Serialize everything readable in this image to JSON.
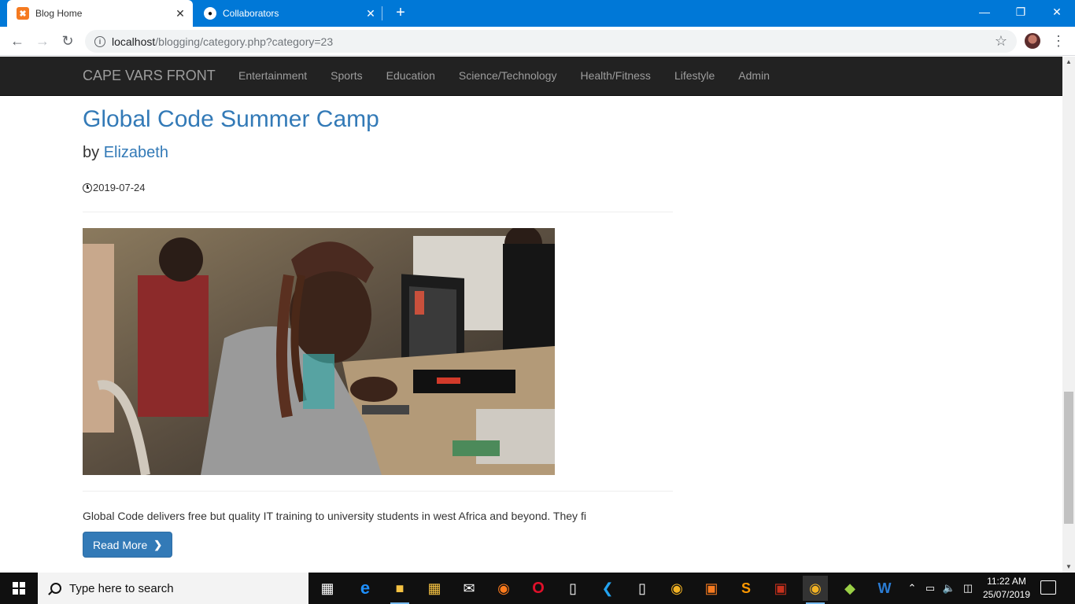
{
  "browser": {
    "tabs": [
      {
        "title": "Blog Home",
        "active": true,
        "icon": "xampp-icon"
      },
      {
        "title": "Collaborators",
        "active": false,
        "icon": "github-icon"
      }
    ],
    "new_tab_label": "+",
    "url_host": "localhost",
    "url_path": "/blogging/category.php?category=23",
    "accent_color": "#0078d7"
  },
  "site": {
    "brand": "CAPE VARS FRONT",
    "nav": [
      "Entertainment",
      "Sports",
      "Education",
      "Science/Technology",
      "Health/Fitness",
      "Lifestyle",
      "Admin"
    ],
    "navbar_color": "#222222",
    "link_color": "#337ab7"
  },
  "post": {
    "title": "Global Code Summer Camp",
    "by_label": "by",
    "author": "Elizabeth",
    "date": "2019-07-24",
    "image_alt": "Student working on electronics at a computer lab",
    "excerpt": "Global Code delivers free but quality IT training to university students in west Africa and beyond. They fi",
    "read_more_label": "Read More"
  },
  "taskbar": {
    "search_placeholder": "Type here to search",
    "time": "11:22 AM",
    "date": "25/07/2019",
    "apps": [
      "task-view-icon",
      "edge-icon",
      "file-explorer-icon",
      "store-icon",
      "mail-icon",
      "firefox-icon",
      "opera-icon",
      "file-icon",
      "vscode-icon",
      "file-icon",
      "chrome-icon",
      "xampp-icon",
      "sublime-icon",
      "filezilla-icon",
      "chrome-icon",
      "git-icon",
      "word-icon"
    ]
  }
}
